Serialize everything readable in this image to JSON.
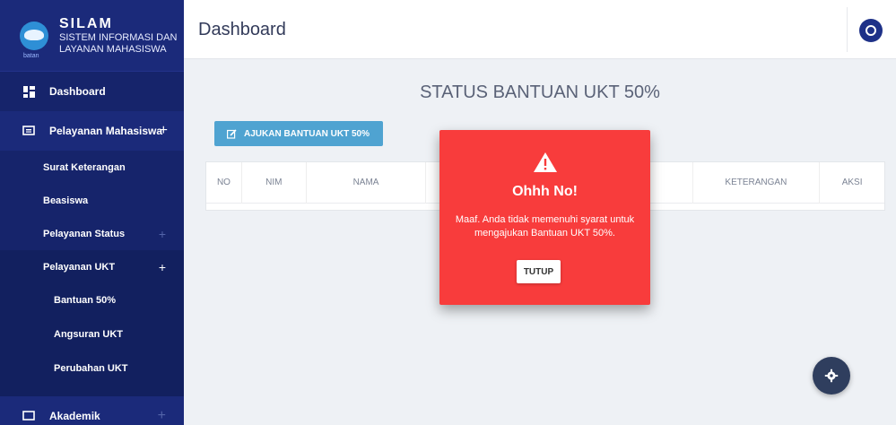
{
  "brand": {
    "name": "SILAM",
    "subtitle_line1": "SISTEM INFORMASI DAN",
    "subtitle_line2": "LAYANAN MAHASISWA",
    "logo_caption": "batan"
  },
  "header": {
    "title": "Dashboard"
  },
  "sidebar": {
    "items": [
      {
        "label": "Dashboard",
        "icon": "dashboard-icon"
      },
      {
        "label": "Pelayanan Mahasiswa",
        "icon": "monitor-icon",
        "toggle": "+"
      },
      {
        "label": "Surat Keterangan"
      },
      {
        "label": "Beasiswa"
      },
      {
        "label": "Pelayanan Status",
        "toggle": "+"
      },
      {
        "label": "Pelayanan UKT",
        "toggle": "+"
      },
      {
        "label": "Bantuan 50%"
      },
      {
        "label": "Angsuran UKT"
      },
      {
        "label": "Perubahan UKT"
      },
      {
        "label": "Akademik",
        "icon": "monitor-icon",
        "toggle": "+"
      }
    ]
  },
  "main": {
    "title": "STATUS BANTUAN UKT 50%",
    "apply_button": "AJUKAN BANTUAN UKT 50%",
    "table": {
      "columns": [
        "NO",
        "NIM",
        "NAMA",
        "KETERANGAN",
        "AKSI"
      ]
    }
  },
  "modal": {
    "title": "Ohhh No!",
    "message": "Maaf. Anda tidak memenuhi syarat untuk mengajukan Bantuan UKT 50%.",
    "button": "TUTUP"
  },
  "colors": {
    "sidebar": "#1b2a7a",
    "modal": "#f83c3c",
    "button": "#4fa3d1"
  }
}
